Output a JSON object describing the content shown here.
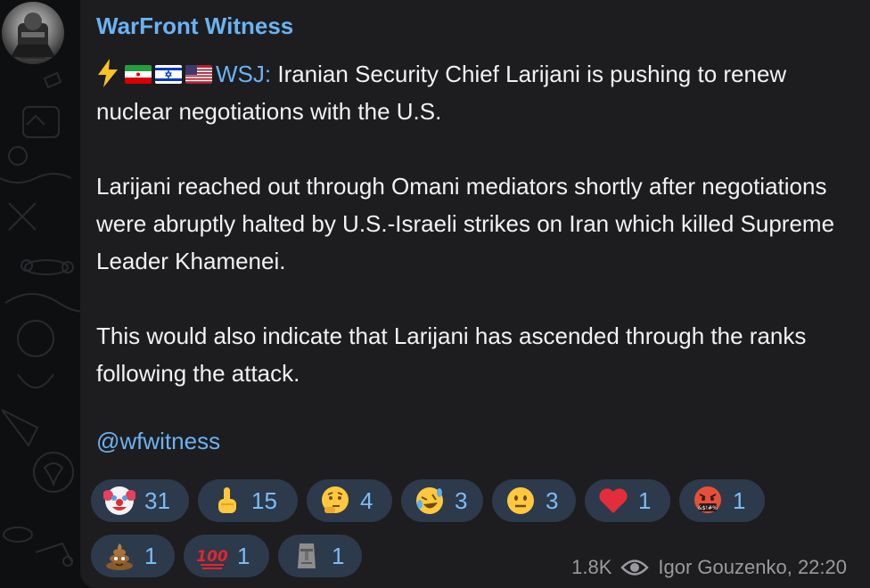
{
  "channel": {
    "name": "WarFront Witness"
  },
  "message": {
    "source_label": "WSJ:",
    "line1": "Iranian Security Chief Larijani is pushing to renew nuclear negotiations with the U.S.",
    "paragraph2": "Larijani reached out through Omani mediators shortly after negotiations were abruptly halted by U.S.-Israeli strikes on Iran which killed Supreme Leader Khamenei.",
    "paragraph3": "This would also indicate that Larijani has ascended through the ranks following the attack.",
    "handle": "@wfwitness"
  },
  "icons": {
    "prefix": [
      "lightning-icon",
      "iran-flag-icon",
      "israel-flag-icon",
      "usa-flag-icon"
    ]
  },
  "reactions": [
    {
      "icon": "clown-face",
      "count": "31"
    },
    {
      "icon": "middle-finger",
      "count": "15"
    },
    {
      "icon": "thinking-face",
      "count": "4"
    },
    {
      "icon": "rolling-laughing-face",
      "count": "3"
    },
    {
      "icon": "neutral-face",
      "count": "3"
    },
    {
      "icon": "red-heart",
      "count": "1"
    },
    {
      "icon": "cursing-face",
      "count": "1"
    },
    {
      "icon": "pile-of-poo",
      "count": "1"
    },
    {
      "icon": "hundred-points",
      "count": "1"
    },
    {
      "icon": "moai",
      "count": "1"
    }
  ],
  "meta": {
    "views": "1.8K",
    "author_time": "Igor Gouzenko, 22:20"
  },
  "colors": {
    "link": "#6ab3f3",
    "bubble": "#1d1d1f",
    "reaction_bg": "#2c3a4c",
    "reaction_text": "#7cbcf5"
  }
}
